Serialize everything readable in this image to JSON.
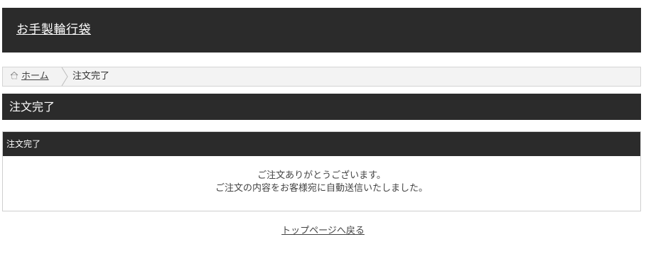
{
  "header": {
    "site_title": "お手製輪行袋"
  },
  "breadcrumb": {
    "home_label": "ホーム",
    "current_label": "注文完了"
  },
  "page": {
    "title": "注文完了"
  },
  "panel": {
    "title": "注文完了",
    "message_line1": "ご注文ありがとうございます。",
    "message_line2": "ご注文の内容をお客様宛に自動送信いたしました。"
  },
  "footer_link": {
    "label": "トップページへ戻る"
  },
  "icons": {
    "home": "home-icon",
    "separator": "chevron-right-icon"
  },
  "colors": {
    "header_bg": "#2b2b2b",
    "breadcrumb_bg": "#f3f3f3",
    "text": "#333333"
  }
}
